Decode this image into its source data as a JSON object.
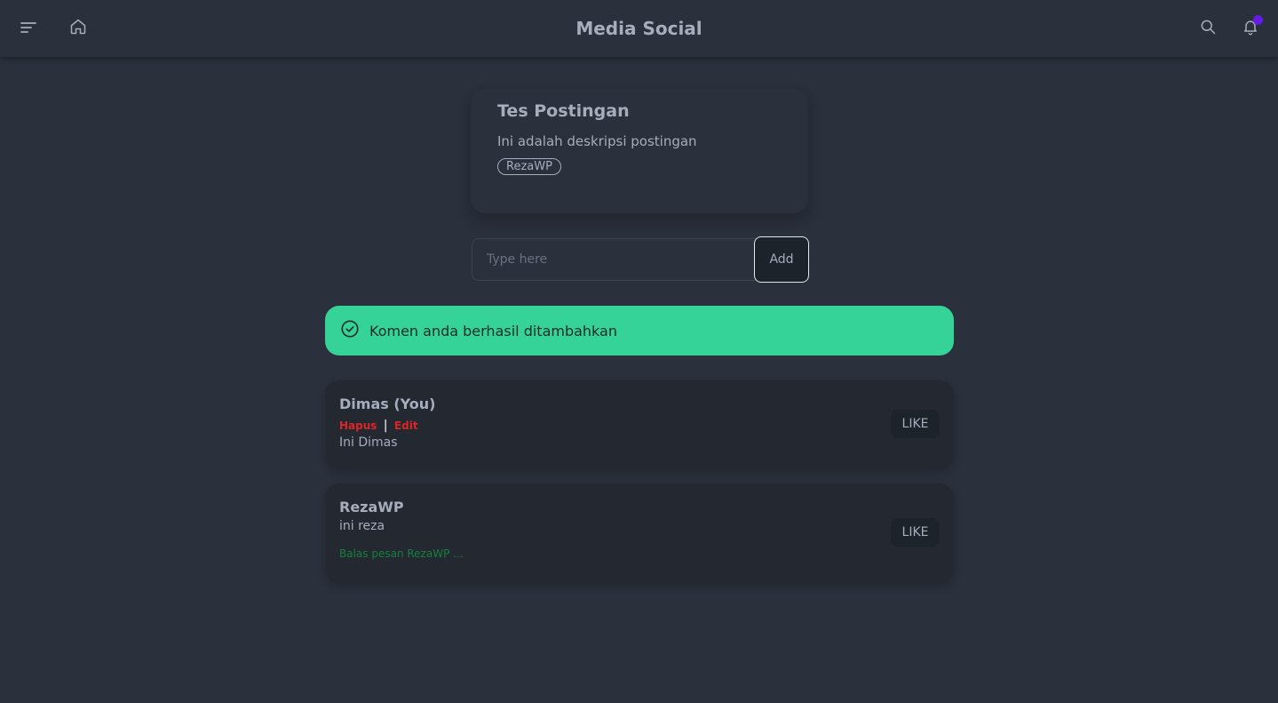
{
  "navbar": {
    "title": "Media Social",
    "menu_icon": "menu-icon",
    "home_icon": "home-icon",
    "search_icon": "search-icon",
    "bell_icon": "bell-icon",
    "notification_badge_color": "#661ae6"
  },
  "post": {
    "title": "Tes Postingan",
    "description": "Ini adalah deskripsi postingan",
    "author": "RezaWP"
  },
  "comment_form": {
    "placeholder": "Type here",
    "value": "",
    "add_label": "Add"
  },
  "alert": {
    "icon": "check-circle-icon",
    "message": "Komen anda berhasil ditambahkan",
    "color": "#36d399"
  },
  "comments": [
    {
      "name": "Dimas (You)",
      "delete_label": "Hapus",
      "separator": "|",
      "edit_label": "Edit",
      "text": "Ini Dimas",
      "like_label": "LIKE"
    },
    {
      "name": "RezaWP",
      "text": "ini reza",
      "reply_label": "Balas pesan RezaWP ...",
      "like_label": "LIKE"
    }
  ],
  "colors": {
    "background": "#2a303c",
    "danger": "#dc2626",
    "reply": "#15803d"
  }
}
